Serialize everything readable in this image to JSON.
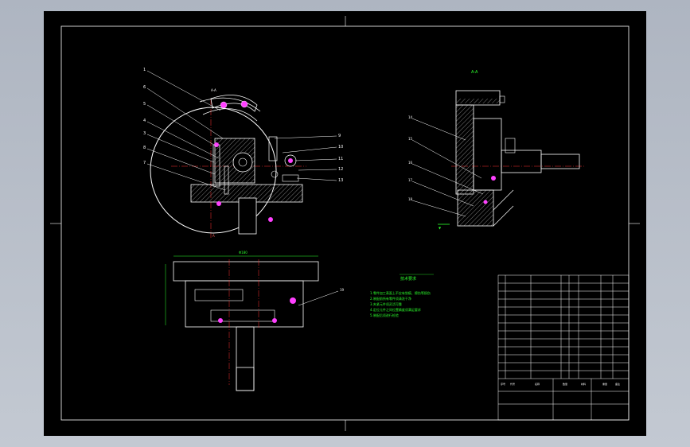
{
  "drawing": {
    "tech_requirements_title": "技术要求",
    "tech_requirements": [
      "1.零件加工表面上不应有划痕、擦伤等损伤",
      "2.装配前所有零件须清洗干净",
      "3.夹紧元件须灵活可靠",
      "4.定位元件之间位置精度须满足要求",
      "5.装配后须进行检验"
    ]
  },
  "colors": {
    "sheet_bg": "#000000",
    "border": "#ffffff",
    "outline": "#ffffff",
    "centerline": "#ff3030",
    "dimension": "#2cff2c",
    "highlight": "#ff40ff",
    "hatch": "#777777",
    "viewport_bg": "#b6bdc8"
  },
  "icons": {
    "section_arrow": "section-arrow-icon"
  }
}
